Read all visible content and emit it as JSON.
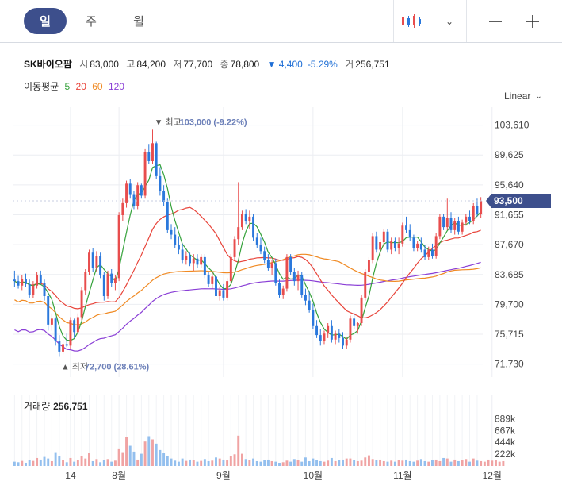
{
  "toolbar": {
    "tabs": [
      {
        "label": "일",
        "active": true
      },
      {
        "label": "주",
        "active": false
      },
      {
        "label": "월",
        "active": false
      }
    ],
    "chart_type_icon": "candlestick-icon",
    "zoom_out_icon": "minus-icon",
    "zoom_in_icon": "plus-icon"
  },
  "stock": {
    "name": "SK바이오팜",
    "open_label": "시",
    "open": "83,000",
    "high_label": "고",
    "high": "84,200",
    "low_label": "저",
    "low": "77,700",
    "close_label": "종",
    "close": "78,800",
    "change": "▼ 4,400",
    "change_pct": "-5.29%",
    "volume_label": "거",
    "volume": "256,751"
  },
  "moving_average": {
    "label": "이동평균",
    "periods": [
      {
        "label": "5",
        "color": "#35a23b"
      },
      {
        "label": "20",
        "color": "#e8443a"
      },
      {
        "label": "60",
        "color": "#f08a23"
      },
      {
        "label": "120",
        "color": "#8a3fd6"
      }
    ]
  },
  "scale_label": "Linear",
  "colors": {
    "up": "#e84d4d",
    "down": "#2a78dc",
    "grid": "#eceef2",
    "current": "#3d4f8c"
  },
  "volume_panel": {
    "label": "거래량",
    "value": "256,751"
  },
  "chart_data": {
    "type": "candlestick",
    "ylim": [
      70000,
      106000
    ],
    "y_ticks": [
      "103,610",
      "99,625",
      "95,640",
      "91,655",
      "87,670",
      "83,685",
      "79,700",
      "75,715",
      "71,730"
    ],
    "current_price_label": "93,500",
    "current_price": 93500,
    "high_annotation": {
      "text": "▼ 최고",
      "value_text": "103,000 (-9.22%)",
      "value": 103000,
      "index": 40
    },
    "low_annotation": {
      "text": "▲ 최저",
      "value_text": "72,700 (28.61%)",
      "value": 72700,
      "index": 12
    },
    "x_ticks": [
      {
        "label": "14",
        "index": 15
      },
      {
        "label": "8월",
        "index": 28
      },
      {
        "label": "9월",
        "index": 56
      },
      {
        "label": "10월",
        "index": 80
      },
      {
        "label": "11월",
        "index": 104
      },
      {
        "label": "12월",
        "index": 128
      }
    ],
    "volume_ticks": [
      "889k",
      "667k",
      "444k",
      "222k"
    ],
    "volume_max": 1000,
    "candles": [
      [
        83000,
        84200,
        82000,
        82800
      ],
      [
        82800,
        83500,
        81800,
        82200
      ],
      [
        82200,
        83600,
        81600,
        83100
      ],
      [
        83100,
        83800,
        82000,
        82400
      ],
      [
        82400,
        83000,
        80600,
        81000
      ],
      [
        81000,
        82800,
        80500,
        82200
      ],
      [
        82200,
        84000,
        81800,
        83600
      ],
      [
        83600,
        84200,
        82400,
        82600
      ],
      [
        82600,
        83000,
        80200,
        80800
      ],
      [
        80800,
        81200,
        76200,
        77000
      ],
      [
        77000,
        78500,
        76200,
        77800
      ],
      [
        77800,
        78000,
        74200,
        74800
      ],
      [
        74800,
        75600,
        72700,
        73400
      ],
      [
        73400,
        75000,
        73000,
        74400
      ],
      [
        74400,
        75800,
        74000,
        74200
      ],
      [
        74200,
        78000,
        73800,
        77600
      ],
      [
        77600,
        77800,
        75200,
        76000
      ],
      [
        76000,
        78500,
        75600,
        78000
      ],
      [
        78000,
        82000,
        77600,
        81600
      ],
      [
        81600,
        84400,
        81000,
        84000
      ],
      [
        84000,
        87000,
        83600,
        86600
      ],
      [
        86600,
        87200,
        84000,
        84600
      ],
      [
        84600,
        86800,
        84000,
        86200
      ],
      [
        86200,
        86600,
        83200,
        83600
      ],
      [
        83600,
        84000,
        80200,
        80800
      ],
      [
        80800,
        84200,
        80400,
        83800
      ],
      [
        83800,
        84400,
        82000,
        82600
      ],
      [
        82600,
        83600,
        81600,
        83200
      ],
      [
        83200,
        92000,
        82800,
        91600
      ],
      [
        91600,
        93800,
        90800,
        93200
      ],
      [
        93200,
        96200,
        92600,
        95800
      ],
      [
        95800,
        96400,
        93800,
        94400
      ],
      [
        94400,
        94800,
        92400,
        92800
      ],
      [
        92800,
        96000,
        92400,
        95600
      ],
      [
        95600,
        95800,
        93800,
        94200
      ],
      [
        94200,
        100400,
        93800,
        100000
      ],
      [
        100000,
        101000,
        98400,
        98800
      ],
      [
        98800,
        103000,
        98400,
        101200
      ],
      [
        101200,
        101400,
        96400,
        96800
      ],
      [
        96800,
        98000,
        94200,
        94800
      ],
      [
        94800,
        95600,
        92800,
        93400
      ],
      [
        93400,
        93800,
        89200,
        89600
      ],
      [
        89600,
        90400,
        88400,
        89000
      ],
      [
        89000,
        90000,
        87200,
        87600
      ],
      [
        87600,
        88800,
        86400,
        87000
      ],
      [
        87000,
        87800,
        85200,
        85600
      ],
      [
        85600,
        86800,
        85000,
        86200
      ],
      [
        86200,
        86600,
        84800,
        85200
      ],
      [
        85200,
        86400,
        84200,
        85800
      ],
      [
        85800,
        86400,
        84600,
        85000
      ],
      [
        85000,
        86400,
        84600,
        86000
      ],
      [
        86000,
        86400,
        83200,
        83600
      ],
      [
        83600,
        84000,
        82000,
        82400
      ],
      [
        82400,
        84000,
        81800,
        83400
      ],
      [
        83400,
        83800,
        80400,
        80800
      ],
      [
        80800,
        82000,
        80200,
        81600
      ],
      [
        81600,
        82400,
        80200,
        80600
      ],
      [
        80600,
        83200,
        80200,
        82800
      ],
      [
        82800,
        86400,
        82600,
        86000
      ],
      [
        86000,
        88800,
        85600,
        88400
      ],
      [
        88400,
        96000,
        87600,
        90000
      ],
      [
        90000,
        92200,
        89600,
        91800
      ],
      [
        91800,
        92400,
        90400,
        90800
      ],
      [
        90800,
        92200,
        89800,
        91400
      ],
      [
        91400,
        91800,
        88200,
        88600
      ],
      [
        88600,
        89200,
        87200,
        87600
      ],
      [
        87600,
        88600,
        86400,
        86800
      ],
      [
        86800,
        87400,
        85200,
        85600
      ],
      [
        85600,
        86400,
        84200,
        84600
      ],
      [
        84600,
        85600,
        83600,
        85200
      ],
      [
        85200,
        85800,
        82200,
        82600
      ],
      [
        82600,
        83000,
        80600,
        81000
      ],
      [
        81000,
        82200,
        80400,
        81800
      ],
      [
        81800,
        86400,
        81400,
        86000
      ],
      [
        86000,
        86400,
        83600,
        84000
      ],
      [
        84000,
        84600,
        82200,
        82800
      ],
      [
        82800,
        84200,
        81600,
        83600
      ],
      [
        83600,
        84000,
        80600,
        81000
      ],
      [
        81000,
        81800,
        79600,
        80200
      ],
      [
        80200,
        81400,
        78600,
        79000
      ],
      [
        79000,
        79800,
        76400,
        76800
      ],
      [
        76800,
        77600,
        75200,
        75600
      ],
      [
        75600,
        76400,
        74200,
        74800
      ],
      [
        74800,
        76200,
        74400,
        75800
      ],
      [
        75800,
        77200,
        75200,
        76800
      ],
      [
        76800,
        77600,
        74600,
        75000
      ],
      [
        75000,
        76200,
        74400,
        75800
      ],
      [
        75800,
        76400,
        74600,
        75200
      ],
      [
        75200,
        76000,
        73800,
        74200
      ],
      [
        74200,
        75400,
        73800,
        75000
      ],
      [
        75000,
        78200,
        74600,
        77800
      ],
      [
        77800,
        78600,
        76400,
        76800
      ],
      [
        76800,
        77400,
        75800,
        77200
      ],
      [
        77200,
        81000,
        76800,
        80600
      ],
      [
        80600,
        84400,
        80200,
        84000
      ],
      [
        84000,
        86000,
        83400,
        85600
      ],
      [
        85600,
        89200,
        85200,
        88800
      ],
      [
        88800,
        89400,
        86600,
        87000
      ],
      [
        87000,
        88400,
        86200,
        88000
      ],
      [
        88000,
        89800,
        87400,
        89400
      ],
      [
        89400,
        89800,
        86600,
        87000
      ],
      [
        87000,
        88600,
        86400,
        88200
      ],
      [
        88200,
        88600,
        86800,
        87200
      ],
      [
        87200,
        88600,
        86400,
        87800
      ],
      [
        87800,
        90600,
        87400,
        90200
      ],
      [
        90200,
        91400,
        89200,
        89600
      ],
      [
        89600,
        90400,
        88200,
        88600
      ],
      [
        88600,
        89000,
        86800,
        87200
      ],
      [
        87200,
        88200,
        86800,
        87800
      ],
      [
        87800,
        88600,
        86600,
        87000
      ],
      [
        87000,
        87600,
        85600,
        86000
      ],
      [
        86000,
        87400,
        85600,
        87000
      ],
      [
        87000,
        87800,
        85800,
        86200
      ],
      [
        86200,
        89200,
        85800,
        88800
      ],
      [
        88800,
        91800,
        88400,
        91400
      ],
      [
        91400,
        91800,
        89600,
        90000
      ],
      [
        90000,
        93800,
        89600,
        91200
      ],
      [
        91200,
        92000,
        89200,
        89600
      ],
      [
        89600,
        91200,
        89000,
        90800
      ],
      [
        90800,
        91400,
        89000,
        89400
      ],
      [
        89400,
        91000,
        89000,
        90600
      ],
      [
        90600,
        91800,
        90200,
        91400
      ],
      [
        91400,
        92200,
        90400,
        90800
      ],
      [
        90800,
        93200,
        90400,
        92800
      ],
      [
        92800,
        93800,
        91400,
        91800
      ],
      [
        91800,
        94000,
        91200,
        93500
      ]
    ],
    "volumes": [
      80,
      70,
      95,
      60,
      110,
      95,
      150,
      120,
      170,
      140,
      90,
      260,
      180,
      110,
      70,
      150,
      80,
      110,
      190,
      140,
      240,
      90,
      130,
      70,
      110,
      130,
      80,
      100,
      330,
      260,
      550,
      380,
      270,
      120,
      230,
      460,
      560,
      500,
      420,
      300,
      240,
      190,
      140,
      100,
      80,
      140,
      95,
      120,
      110,
      80,
      95,
      130,
      90,
      100,
      160,
      140,
      120,
      110,
      180,
      220,
      570,
      230,
      130,
      110,
      140,
      90,
      80,
      110,
      120,
      90,
      80,
      60,
      70,
      100,
      80,
      130,
      110,
      80,
      160,
      90,
      140,
      110,
      90,
      80,
      100,
      150,
      90,
      110,
      120,
      140,
      140,
      110,
      90,
      100,
      160,
      200,
      130,
      110,
      120,
      90,
      80,
      100,
      80,
      110,
      100,
      120,
      90,
      80,
      100,
      130,
      90,
      80,
      110,
      120,
      90,
      150,
      140,
      80,
      120,
      90,
      110,
      130,
      80,
      140,
      100,
      90,
      80,
      120,
      100,
      110,
      80,
      90
    ]
  }
}
